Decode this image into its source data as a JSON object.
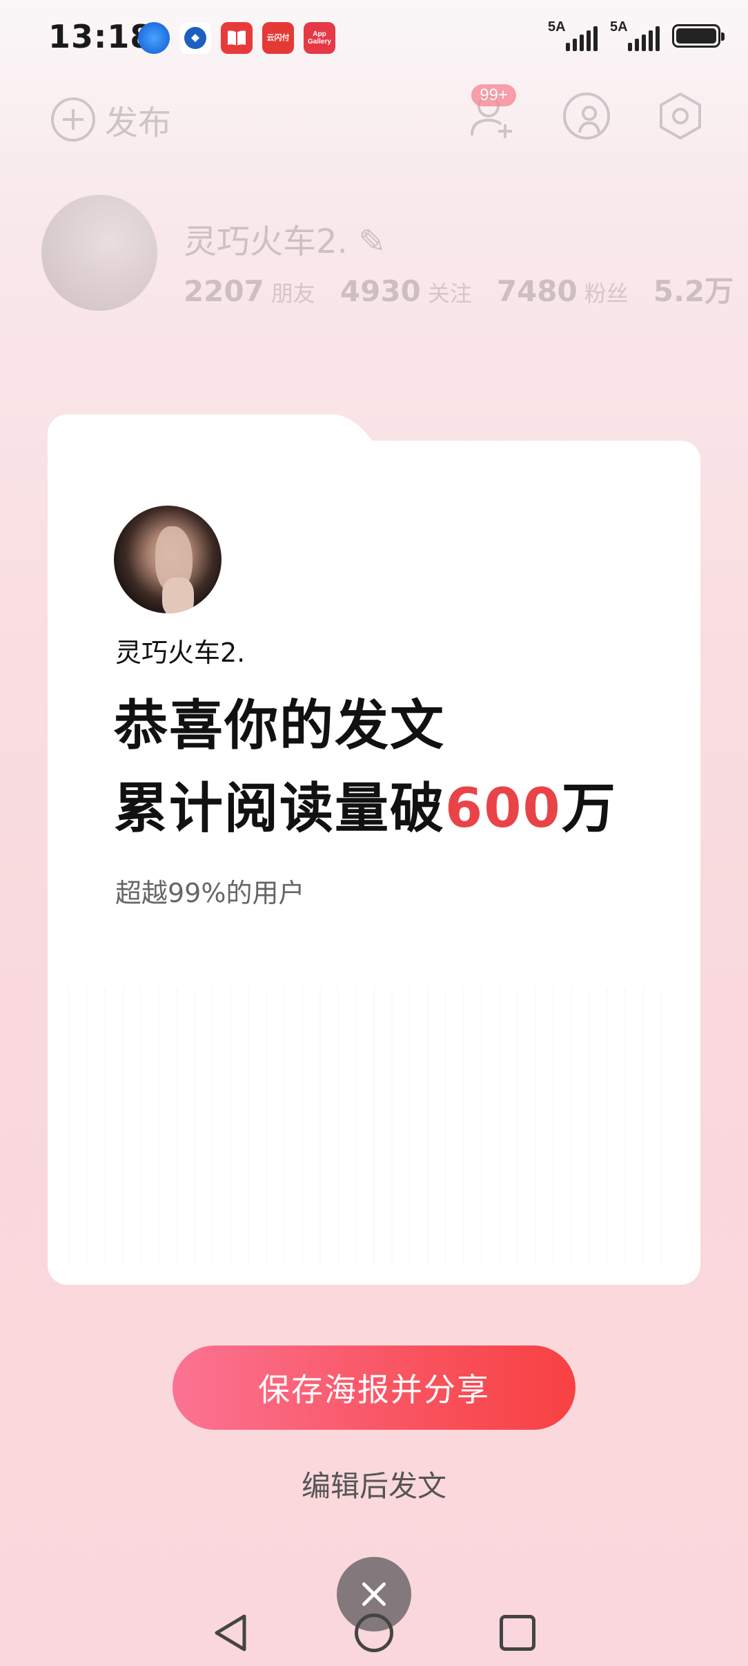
{
  "status_bar": {
    "time": "13:18",
    "app_labels": {
      "pay": "云闪付",
      "gallery": "App Gallery"
    },
    "signal1": "5A",
    "signal2": "5A"
  },
  "header": {
    "publish_label": "发布",
    "notification_badge": "99+"
  },
  "profile": {
    "name": "灵巧火车2.",
    "stats": [
      {
        "value": "2207",
        "label": "朋友"
      },
      {
        "value": "4930",
        "label": "关注"
      },
      {
        "value": "7480",
        "label": "粉丝"
      },
      {
        "value": "5.2万",
        "label": ""
      }
    ]
  },
  "card": {
    "username": "灵巧火车2.",
    "headline_line1": "恭喜你的发文",
    "headline_line2_prefix": "累计阅读量破",
    "headline_line2_highlight": "600",
    "headline_line2_suffix": "万",
    "subtitle": "超越99%的用户",
    "highlight_color": "#e84448"
  },
  "actions": {
    "save_button": "保存海报并分享",
    "edit_link": "编辑后发文"
  },
  "icons": {
    "add_friend": "add-user-icon",
    "messages": "user-badge-icon",
    "settings": "settings-icon",
    "close": "close-icon"
  }
}
